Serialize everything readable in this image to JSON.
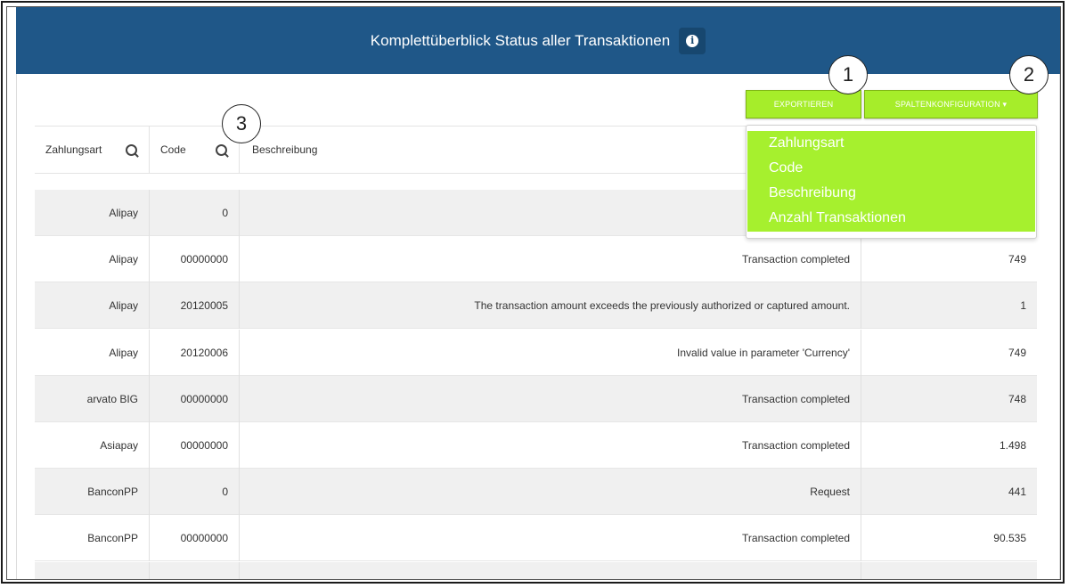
{
  "header": {
    "title": "Komplettüberblick Status aller Transaktionen",
    "info_icon": "info-icon"
  },
  "toolbar": {
    "export_label": "EXPORTIEREN",
    "column_config_label": "SPALTENKONFIGURATION ▾"
  },
  "callouts": [
    "1",
    "2",
    "3"
  ],
  "columns": [
    {
      "label": "Zahlungsart",
      "searchable": true
    },
    {
      "label": "Code",
      "searchable": true
    },
    {
      "label": "Beschreibung",
      "searchable": false
    }
  ],
  "column_menu": [
    "Zahlungsart",
    "Code",
    "Beschreibung",
    "Anzahl Transaktionen"
  ],
  "rows": [
    {
      "zahlungsart": "Alipay",
      "code": "0",
      "beschreibung": "",
      "anzahl": ""
    },
    {
      "zahlungsart": "Alipay",
      "code": "00000000",
      "beschreibung": "Transaction completed",
      "anzahl": "749"
    },
    {
      "zahlungsart": "Alipay",
      "code": "20120005",
      "beschreibung": "The transaction amount exceeds the previously authorized or captured amount.",
      "anzahl": "1"
    },
    {
      "zahlungsart": "Alipay",
      "code": "20120006",
      "beschreibung": "Invalid value in parameter 'Currency'",
      "anzahl": "749"
    },
    {
      "zahlungsart": "arvato BIG",
      "code": "00000000",
      "beschreibung": "Transaction completed",
      "anzahl": "748"
    },
    {
      "zahlungsart": "Asiapay",
      "code": "00000000",
      "beschreibung": "Transaction completed",
      "anzahl": "1.498"
    },
    {
      "zahlungsart": "BanconPP",
      "code": "0",
      "beschreibung": "Request",
      "anzahl": "441"
    },
    {
      "zahlungsart": "BanconPP",
      "code": "00000000",
      "beschreibung": "Transaction completed",
      "anzahl": "90.535"
    },
    {
      "zahlungsart": "",
      "code": "",
      "beschreibung": "",
      "anzahl": ""
    }
  ],
  "colors": {
    "header_bg": "#1f5788",
    "accent_green": "#a6ed2a",
    "row_alt": "#f0f0f0"
  }
}
